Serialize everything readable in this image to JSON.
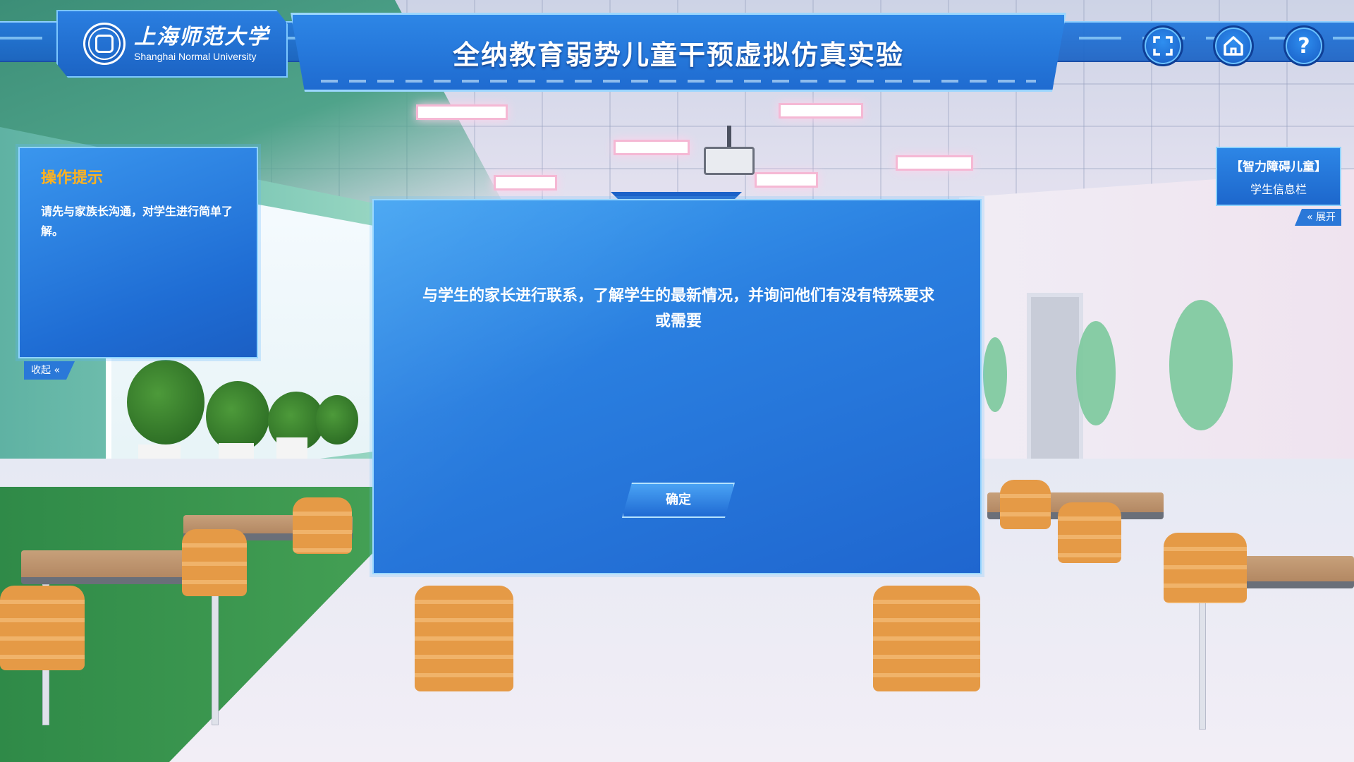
{
  "header": {
    "logo": {
      "name_cn": "上海师范大学",
      "name_en": "Shanghai Normal University"
    },
    "title": "全纳教育弱势儿童干预虚拟仿真实验",
    "buttons": [
      {
        "id": "fullscreen",
        "icon": "fullscreen-icon",
        "glyph": "⛶"
      },
      {
        "id": "home",
        "icon": "home-icon",
        "glyph": "⌂"
      },
      {
        "id": "help",
        "icon": "help-icon",
        "glyph": "?"
      }
    ]
  },
  "tips_panel": {
    "title": "操作提示",
    "text": "请先与家族长沟通，对学生进行简单了解。",
    "collapse_label": "收起 «"
  },
  "student_panel": {
    "type": "【智力障碍儿童】",
    "label": "学生信息栏",
    "expand_label": "« 展开"
  },
  "dialog": {
    "message": "与学生的家长进行联系，了解学生的最新情况，并询问他们有没有特殊要求或需要",
    "confirm_label": "确定"
  },
  "colors": {
    "primary_blue": "#1f6bd0",
    "accent_orange": "#ffb21e",
    "border_light": "#8ed3ff"
  }
}
